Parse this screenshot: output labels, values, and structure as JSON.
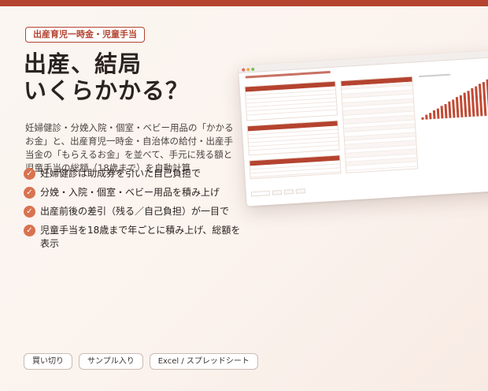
{
  "header": {
    "tag": "出産育児一時金・児童手当",
    "title_line1": "出産、結局",
    "title_line2": "いくらかかる？"
  },
  "description": "妊婦健診・分娩入院・個室・ベビー用品の「かかるお金」と、出産育児一時金・自治体の給付・出産手当金の「もらえるお金」を並べて、手元に残る額と児童手当の総額（18歳まで）を自動計算",
  "features": [
    "妊婦健診は助成券を引いた自己負担で",
    "分娩・入院・個室・ベビー用品を積み上げ",
    "出産前後の差引（残る／自己負担）が一目で",
    "児童手当を18歳まで年ごとに積み上げ、総額を表示"
  ],
  "bottom_tags": [
    "買い切り",
    "サンプル入り",
    "Excel / スプレッドシート"
  ],
  "colors": {
    "accent": "#b4432f",
    "check": "#d8734f",
    "top_bar": "#b4432f"
  },
  "icons": {
    "feature_bullet": "check-icon"
  },
  "spreadsheet": {
    "chart_bars": [
      4,
      7,
      10,
      13,
      16,
      19,
      22,
      25,
      28,
      31,
      34,
      37,
      40,
      43,
      46,
      49,
      52,
      55
    ]
  }
}
